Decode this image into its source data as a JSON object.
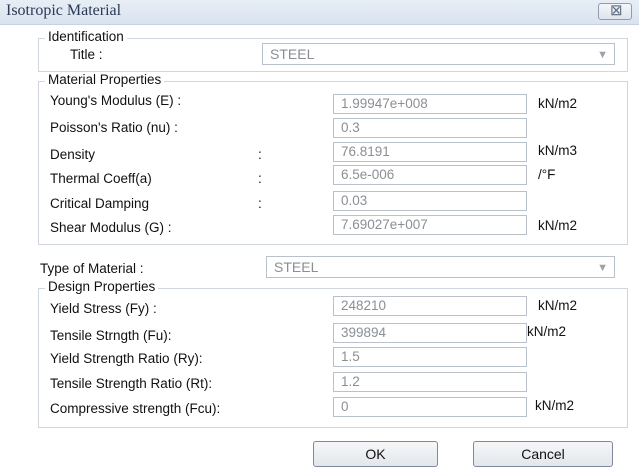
{
  "window": {
    "title": "Isotropic Material",
    "close_glyph": "⊠"
  },
  "identification": {
    "legend": "Identification",
    "title_label": "Title :",
    "title_value": "STEEL"
  },
  "material_properties": {
    "legend": "Material Properties",
    "rows": [
      {
        "label": "Young's Modulus (E) :",
        "value": "1.99947e+008",
        "unit": "kN/m2"
      },
      {
        "label": "Poisson's Ratio (nu)  :",
        "value": "0.3",
        "unit": ""
      },
      {
        "label": "Density",
        "colon": ":",
        "value": "76.8191",
        "unit": "kN/m3"
      },
      {
        "label": "Thermal Coeff(a)",
        "colon": ":",
        "value": "6.5e-006",
        "unit": "/°F"
      },
      {
        "label": "Critical Damping",
        "colon": ":",
        "value": "0.03",
        "unit": ""
      },
      {
        "label": "Shear Modulus (G)  :",
        "value": "7.69027e+007",
        "unit": "kN/m2"
      }
    ]
  },
  "type_of_material": {
    "label": "Type of Material :",
    "value": "STEEL"
  },
  "design_properties": {
    "legend": "Design Properties",
    "rows": [
      {
        "label": "Yield Stress (Fy) :",
        "value": "248210",
        "unit": "kN/m2"
      },
      {
        "label": "Tensile Strngth (Fu):",
        "value": "399894",
        "unit": "kN/m2"
      },
      {
        "label": "Yield Strength Ratio (Ry):",
        "value": "1.5",
        "unit": ""
      },
      {
        "label": "Tensile Strength Ratio (Rt):",
        "value": "1.2",
        "unit": ""
      },
      {
        "label": "Compressive strength (Fcu):",
        "value": "0",
        "unit": "kN/m2"
      }
    ]
  },
  "buttons": {
    "ok": "OK",
    "cancel": "Cancel"
  }
}
